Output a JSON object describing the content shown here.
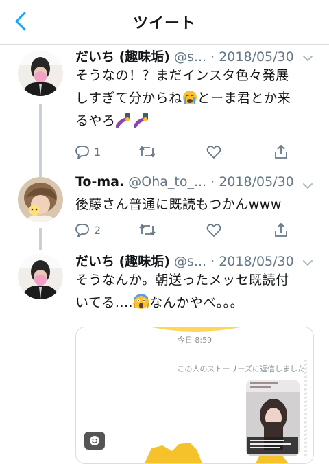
{
  "header": {
    "title": "ツイート"
  },
  "tweets": [
    {
      "name": "だいち (趣味垢)",
      "handle": "@s...",
      "date": "· 2018/05/30",
      "text_line1": "そうなの！？まだインスタ色々発展",
      "text_line2_a": "しすぎて分からね",
      "text_line2_b": "とーま君とか来",
      "text_line3": "るやろ",
      "reply_count": "1",
      "retweet_count": "",
      "like_count": ""
    },
    {
      "name": "To-ma.",
      "handle": "@Oha_to_...",
      "date": "· 2018/05/30",
      "text_line1": "後藤さん普通に既読もつかんwww",
      "reply_count": "2",
      "retweet_count": "",
      "like_count": ""
    },
    {
      "name": "だいち (趣味垢)",
      "handle": "@s...",
      "date": "· 2018/05/30",
      "text_line1": "そうなんか。朝送ったメッセ既読付",
      "text_line2_a": "いてる....",
      "text_line2_b": "なんかやべ。。。",
      "reply_count": "",
      "retweet_count": "",
      "like_count": ""
    }
  ],
  "card": {
    "time": "今日 8:59",
    "reply_label": "この人のストーリーズに返信しました"
  },
  "colors": {
    "accent": "#1da1f2",
    "icon_gray": "#657786",
    "thread_line": "#c8d0d7"
  }
}
